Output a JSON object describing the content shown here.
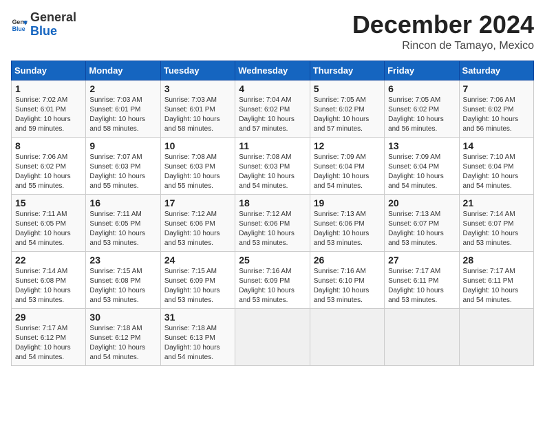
{
  "header": {
    "logo_general": "General",
    "logo_blue": "Blue",
    "month_title": "December 2024",
    "location": "Rincon de Tamayo, Mexico"
  },
  "calendar": {
    "days_of_week": [
      "Sunday",
      "Monday",
      "Tuesday",
      "Wednesday",
      "Thursday",
      "Friday",
      "Saturday"
    ],
    "weeks": [
      [
        {
          "day": "",
          "info": ""
        },
        {
          "day": "2",
          "info": "Sunrise: 7:03 AM\nSunset: 6:01 PM\nDaylight: 10 hours\nand 58 minutes."
        },
        {
          "day": "3",
          "info": "Sunrise: 7:03 AM\nSunset: 6:01 PM\nDaylight: 10 hours\nand 58 minutes."
        },
        {
          "day": "4",
          "info": "Sunrise: 7:04 AM\nSunset: 6:02 PM\nDaylight: 10 hours\nand 57 minutes."
        },
        {
          "day": "5",
          "info": "Sunrise: 7:05 AM\nSunset: 6:02 PM\nDaylight: 10 hours\nand 57 minutes."
        },
        {
          "day": "6",
          "info": "Sunrise: 7:05 AM\nSunset: 6:02 PM\nDaylight: 10 hours\nand 56 minutes."
        },
        {
          "day": "7",
          "info": "Sunrise: 7:06 AM\nSunset: 6:02 PM\nDaylight: 10 hours\nand 56 minutes."
        }
      ],
      [
        {
          "day": "1",
          "info": "Sunrise: 7:02 AM\nSunset: 6:01 PM\nDaylight: 10 hours\nand 59 minutes."
        },
        {
          "day": "",
          "info": ""
        },
        {
          "day": "",
          "info": ""
        },
        {
          "day": "",
          "info": ""
        },
        {
          "day": "",
          "info": ""
        },
        {
          "day": "",
          "info": ""
        },
        {
          "day": "",
          "info": ""
        }
      ],
      [
        {
          "day": "8",
          "info": "Sunrise: 7:06 AM\nSunset: 6:02 PM\nDaylight: 10 hours\nand 55 minutes."
        },
        {
          "day": "9",
          "info": "Sunrise: 7:07 AM\nSunset: 6:03 PM\nDaylight: 10 hours\nand 55 minutes."
        },
        {
          "day": "10",
          "info": "Sunrise: 7:08 AM\nSunset: 6:03 PM\nDaylight: 10 hours\nand 55 minutes."
        },
        {
          "day": "11",
          "info": "Sunrise: 7:08 AM\nSunset: 6:03 PM\nDaylight: 10 hours\nand 54 minutes."
        },
        {
          "day": "12",
          "info": "Sunrise: 7:09 AM\nSunset: 6:04 PM\nDaylight: 10 hours\nand 54 minutes."
        },
        {
          "day": "13",
          "info": "Sunrise: 7:09 AM\nSunset: 6:04 PM\nDaylight: 10 hours\nand 54 minutes."
        },
        {
          "day": "14",
          "info": "Sunrise: 7:10 AM\nSunset: 6:04 PM\nDaylight: 10 hours\nand 54 minutes."
        }
      ],
      [
        {
          "day": "15",
          "info": "Sunrise: 7:11 AM\nSunset: 6:05 PM\nDaylight: 10 hours\nand 54 minutes."
        },
        {
          "day": "16",
          "info": "Sunrise: 7:11 AM\nSunset: 6:05 PM\nDaylight: 10 hours\nand 53 minutes."
        },
        {
          "day": "17",
          "info": "Sunrise: 7:12 AM\nSunset: 6:06 PM\nDaylight: 10 hours\nand 53 minutes."
        },
        {
          "day": "18",
          "info": "Sunrise: 7:12 AM\nSunset: 6:06 PM\nDaylight: 10 hours\nand 53 minutes."
        },
        {
          "day": "19",
          "info": "Sunrise: 7:13 AM\nSunset: 6:06 PM\nDaylight: 10 hours\nand 53 minutes."
        },
        {
          "day": "20",
          "info": "Sunrise: 7:13 AM\nSunset: 6:07 PM\nDaylight: 10 hours\nand 53 minutes."
        },
        {
          "day": "21",
          "info": "Sunrise: 7:14 AM\nSunset: 6:07 PM\nDaylight: 10 hours\nand 53 minutes."
        }
      ],
      [
        {
          "day": "22",
          "info": "Sunrise: 7:14 AM\nSunset: 6:08 PM\nDaylight: 10 hours\nand 53 minutes."
        },
        {
          "day": "23",
          "info": "Sunrise: 7:15 AM\nSunset: 6:08 PM\nDaylight: 10 hours\nand 53 minutes."
        },
        {
          "day": "24",
          "info": "Sunrise: 7:15 AM\nSunset: 6:09 PM\nDaylight: 10 hours\nand 53 minutes."
        },
        {
          "day": "25",
          "info": "Sunrise: 7:16 AM\nSunset: 6:09 PM\nDaylight: 10 hours\nand 53 minutes."
        },
        {
          "day": "26",
          "info": "Sunrise: 7:16 AM\nSunset: 6:10 PM\nDaylight: 10 hours\nand 53 minutes."
        },
        {
          "day": "27",
          "info": "Sunrise: 7:17 AM\nSunset: 6:11 PM\nDaylight: 10 hours\nand 53 minutes."
        },
        {
          "day": "28",
          "info": "Sunrise: 7:17 AM\nSunset: 6:11 PM\nDaylight: 10 hours\nand 54 minutes."
        }
      ],
      [
        {
          "day": "29",
          "info": "Sunrise: 7:17 AM\nSunset: 6:12 PM\nDaylight: 10 hours\nand 54 minutes."
        },
        {
          "day": "30",
          "info": "Sunrise: 7:18 AM\nSunset: 6:12 PM\nDaylight: 10 hours\nand 54 minutes."
        },
        {
          "day": "31",
          "info": "Sunrise: 7:18 AM\nSunset: 6:13 PM\nDaylight: 10 hours\nand 54 minutes."
        },
        {
          "day": "",
          "info": ""
        },
        {
          "day": "",
          "info": ""
        },
        {
          "day": "",
          "info": ""
        },
        {
          "day": "",
          "info": ""
        }
      ]
    ]
  }
}
